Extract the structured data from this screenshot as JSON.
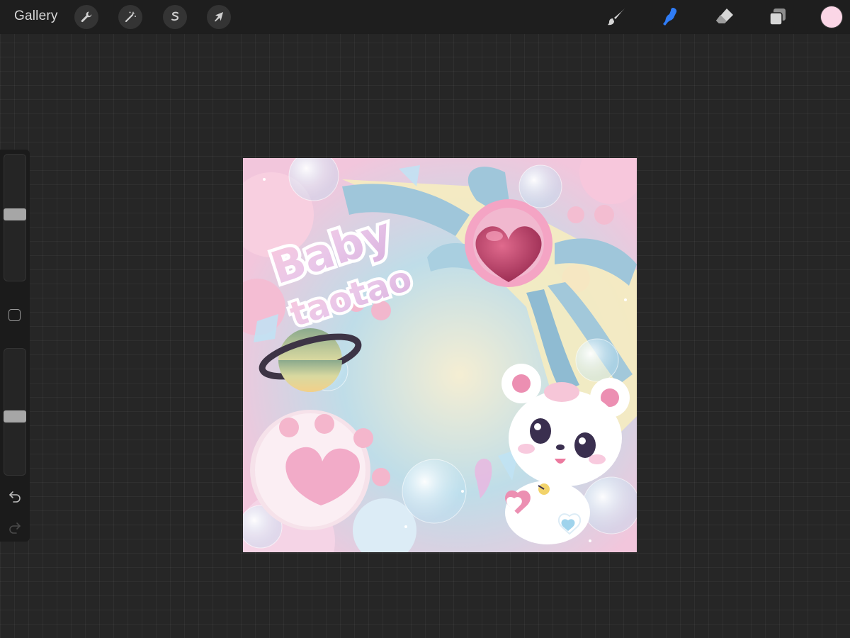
{
  "topbar": {
    "gallery_label": "Gallery",
    "left_tools": [
      {
        "name": "actions",
        "icon": "wrench-icon"
      },
      {
        "name": "adjustments",
        "icon": "magic-wand-icon"
      },
      {
        "name": "selection",
        "icon": "selection-s-icon"
      },
      {
        "name": "transform",
        "icon": "arrow-cursor-icon"
      }
    ],
    "right_tools": [
      {
        "name": "brush",
        "icon": "brush-icon",
        "active": false
      },
      {
        "name": "smudge",
        "icon": "smudge-finger-icon",
        "active": true
      },
      {
        "name": "eraser",
        "icon": "eraser-icon",
        "active": false
      },
      {
        "name": "layers",
        "icon": "layers-icon",
        "active": false
      }
    ],
    "current_color": "#fbd6e6",
    "active_tool_color": "#2f7cf6"
  },
  "sidebar": {
    "brush_size_level": 0.55,
    "opacity_level": 0.5,
    "icons": [
      "modify-square-icon",
      "undo-icon",
      "redo-icon"
    ]
  },
  "canvas": {
    "artwork_text": "Baby taotao"
  }
}
